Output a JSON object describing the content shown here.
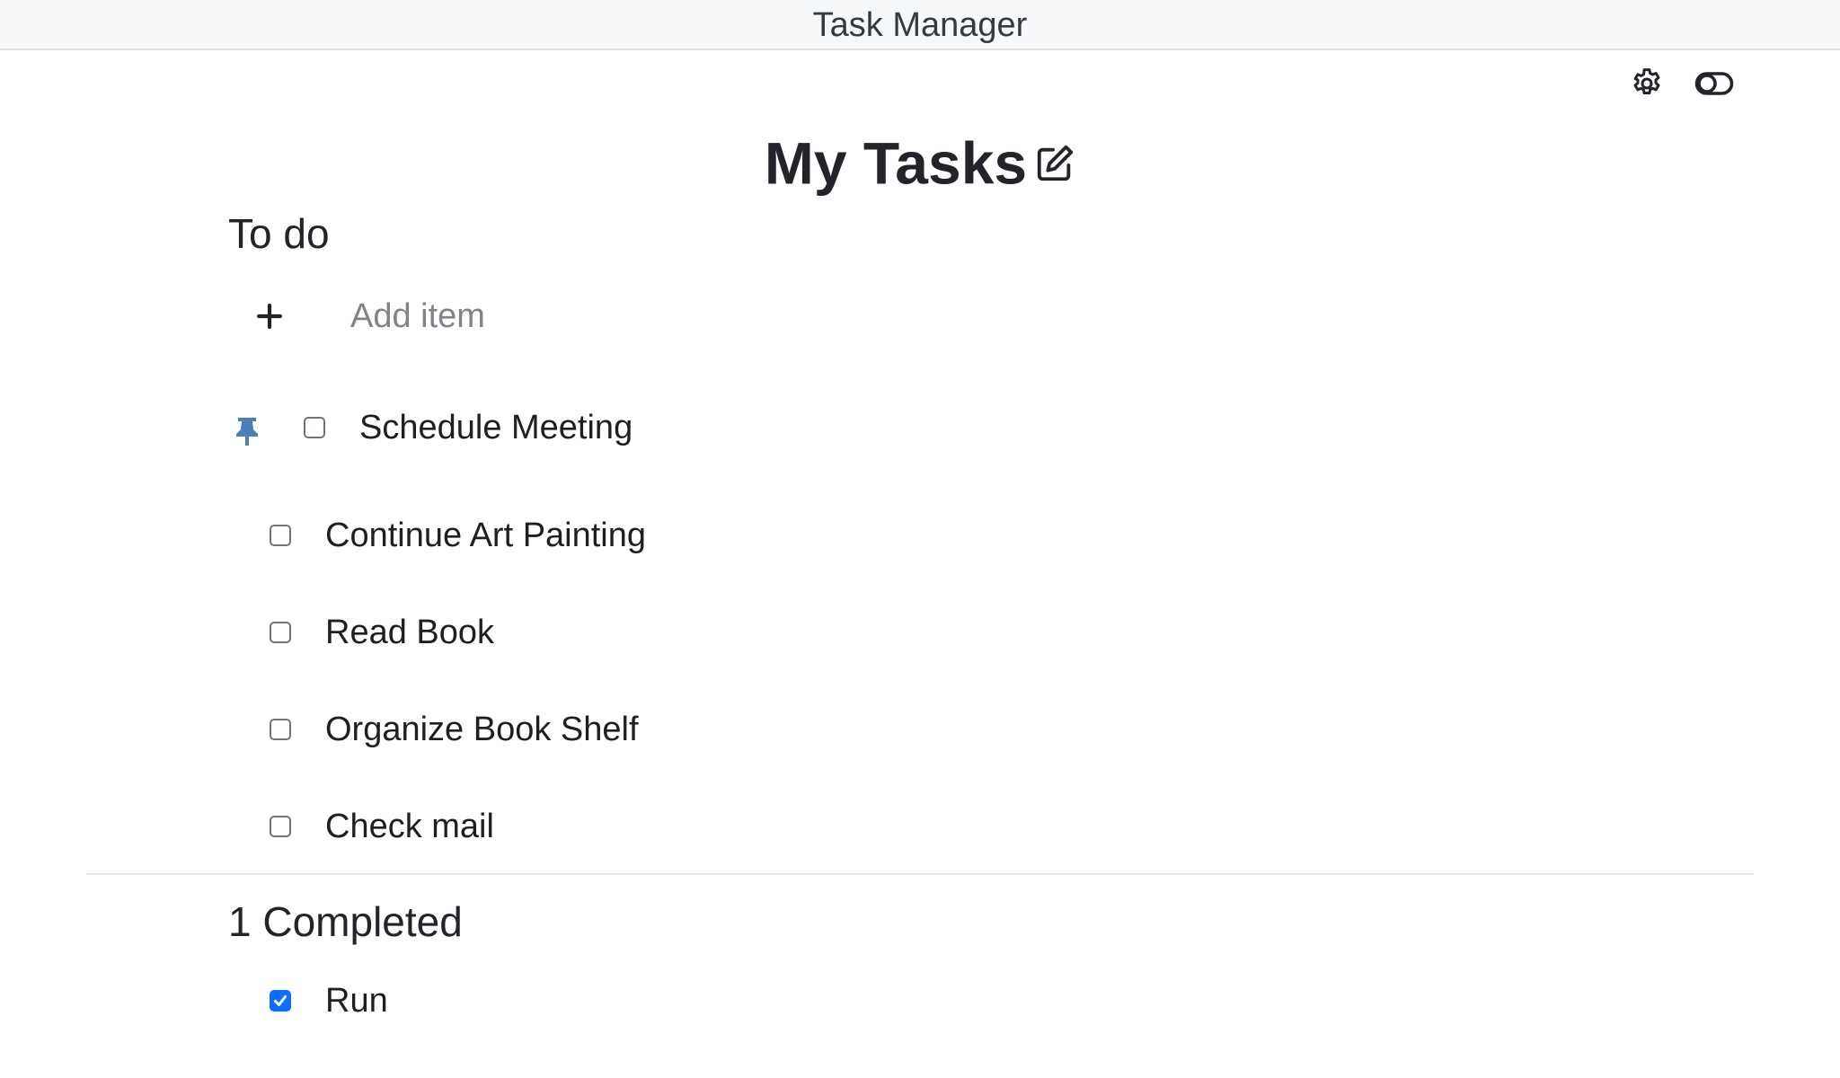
{
  "window": {
    "title": "Task Manager"
  },
  "toolbar": {
    "settings_icon": "gear-icon",
    "theme_icon": "toggle-icon"
  },
  "list": {
    "title": "My Tasks",
    "edit_icon": "edit-icon"
  },
  "todo": {
    "label": "To do",
    "add_placeholder": "Add item",
    "add_value": "",
    "items": [
      {
        "label": "Schedule Meeting",
        "checked": false,
        "pinned": true
      },
      {
        "label": "Continue Art Painting",
        "checked": false,
        "pinned": false
      },
      {
        "label": "Read Book",
        "checked": false,
        "pinned": false
      },
      {
        "label": "Organize Book Shelf",
        "checked": false,
        "pinned": false
      },
      {
        "label": "Check mail",
        "checked": false,
        "pinned": false
      }
    ]
  },
  "completed": {
    "label": "1 Completed",
    "items": [
      {
        "label": "Run",
        "checked": true
      }
    ]
  },
  "colors": {
    "accent": "#0d6efd",
    "pin": "#4a7fb8",
    "text": "#212529",
    "placeholder": "#808489"
  }
}
